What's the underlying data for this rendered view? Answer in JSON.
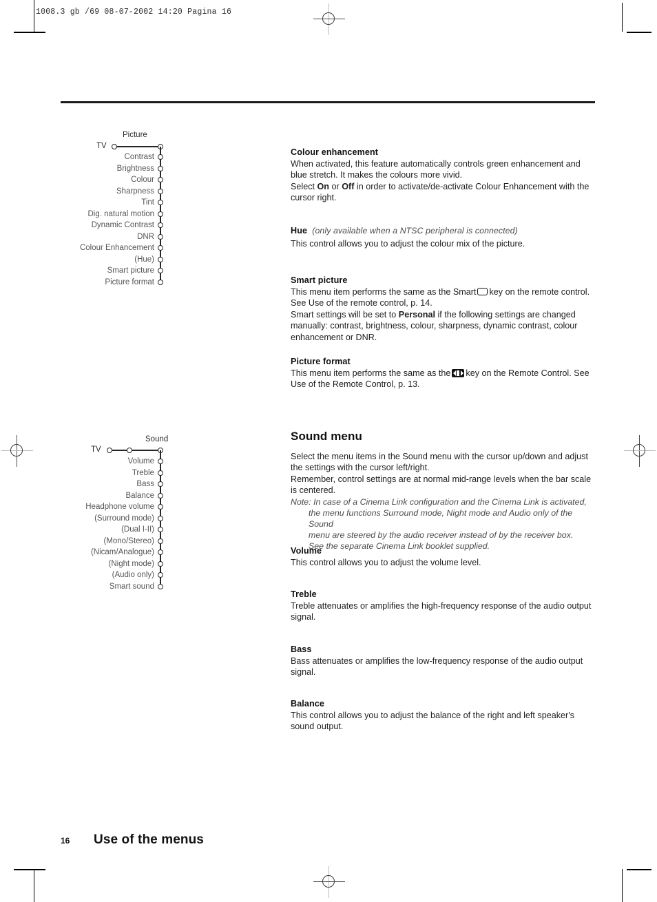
{
  "page": {
    "filestamp": "1008.3 gb /69  08-07-2002  14:20  Pagina 16",
    "page_number": "16",
    "footer_title": "Use of the menus",
    "accent_color": "#262626",
    "label_color": "#555555"
  },
  "picture_tree": {
    "title": "Picture",
    "root_label": "TV",
    "items": [
      "Contrast",
      "Brightness",
      "Colour",
      "Sharpness",
      "Tint",
      "Dig. natural motion",
      "Dynamic Contrast",
      "DNR",
      "Colour Enhancement",
      "(Hue)",
      "Smart picture",
      "Picture format"
    ]
  },
  "sound_tree": {
    "title": "Sound",
    "root_label": "TV",
    "items": [
      "Volume",
      "Treble",
      "Bass",
      "Balance",
      "Headphone volume",
      "(Surround mode)",
      "(Dual I-II)",
      "(Mono/Stereo)",
      "(Nicam/Analogue)",
      "(Night mode)",
      "(Audio only)",
      "Smart sound"
    ]
  },
  "sections": {
    "colour_enhancement": {
      "heading": "Colour enhancement",
      "para1": "When activated, this feature automatically controls green enhancement and blue stretch. It makes the colours more vivid.",
      "para2_a": "Select ",
      "para2_on": "On",
      "para2_b": " or ",
      "para2_off": "Off",
      "para2_c": " in order to activate/de-activate Colour Enhancement with the cursor right."
    },
    "hue": {
      "heading": "Hue",
      "heading_note": "(only available when a NTSC peripheral is connected)",
      "para1": "This control allows you to adjust the colour mix of the picture."
    },
    "smart_picture": {
      "heading": "Smart picture",
      "para1_a": "This menu item performs the same as the Smart",
      "key_icon": "smart-key-icon",
      "para1_b": "key on the remote control. See Use of the remote control, p. 14.",
      "para2_a": "Smart settings will be set to ",
      "para2_bold": "Personal",
      "para2_b": " if the following settings are changed manually: contrast, brightness, colour, sharpness, dynamic contrast, colour enhancement or DNR."
    },
    "picture_format": {
      "heading": "Picture format",
      "para1_a": "This menu item performs the same as the",
      "key_icon": "picture-format-key-icon",
      "para1_b": "key on the Remote Control. See Use of the Remote Control, p. 13."
    },
    "sound_menu": {
      "heading": "Sound menu",
      "para1": "Select the menu items in the Sound menu with the cursor up/down and adjust the settings with the cursor left/right.",
      "para2": "Remember, control settings are at normal mid-range levels when the bar scale is centered.",
      "note_lead": "Note:",
      "note_line1": " In case of a Cinema Link configuration and the Cinema Link is activated,",
      "note_line2": "the menu functions Surround mode, Night mode and Audio only of the Sound",
      "note_line3": "menu are steered by the audio receiver instead of by the receiver box.",
      "note_line4": "See the separate Cinema Link booklet supplied."
    },
    "volume": {
      "heading": "Volume",
      "para1": "This control allows you to adjust the volume level."
    },
    "treble": {
      "heading": "Treble",
      "para1": "Treble attenuates or amplifies the high-frequency response of the audio output signal."
    },
    "bass": {
      "heading": "Bass",
      "para1": "Bass attenuates or amplifies the low-frequency response of the audio output signal."
    },
    "balance": {
      "heading": "Balance",
      "para1": "This control allows you to adjust the balance of the right and left speaker's sound output."
    }
  }
}
